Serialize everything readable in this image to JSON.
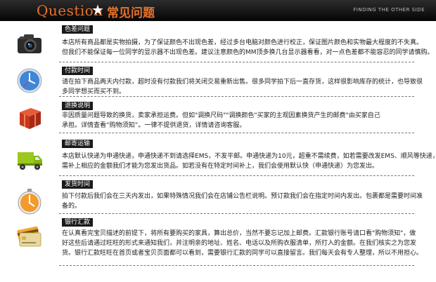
{
  "header": {
    "title_en": "Question",
    "star": "★",
    "title_cn": "常见问题",
    "right_text": "FINDING THE OTHER SIDE"
  },
  "sections": [
    {
      "icon": "camera-icon",
      "label": "色差问题",
      "lines": [
        "本店所有商品都是实物拍摄，为了保证颜色不出现色差，经过多台电脑对颜色进行校正，保证图片颜色和实物最大程度的不失真。",
        "但我们不能保证每一位同学的显示器不出现色差。建议注意颜色的MM顶多换几台显示器看看，对一点色差都不能容忍的同学请慎购。"
      ]
    },
    {
      "icon": "clock-icon",
      "label": "付款时间",
      "lines": [
        "请在拍下商品两天内付款，超时没有付款我们将关闭交易重新出售。很多同学拍下后一直存货，这样很影响库存的统计，也导致很",
        "多同学想买而买不到。"
      ]
    },
    {
      "icon": "package-icon",
      "label": "退换说明",
      "lines": [
        "非因质量问题导致的换货，卖家承担运费。但如\"调换尺码\"\"调换颜色\"买家的主观因素换货产生的邮费\"由买家自己",
        "承担。详情查看“购物须知”。一律不提供退货，详情请咨询客服。"
      ]
    },
    {
      "icon": "truck-icon",
      "label": "邮寄运输",
      "lines": [
        "本店默认快递为申通快递，申通快递不到请选择EMS，不发平邮。申通快递为10元，超重不需续费，如若需要改发EMS、顺风等快递，",
        "需补上相应的金额我们才能为您发出货品。如若没有在特定时间补上，我们会使用默认快（申通快递）为您发出。"
      ]
    },
    {
      "icon": "timer-icon",
      "label": "发货时间",
      "lines": [
        "拍下付款后我们会在三天内发出，如果特殊情况我们会在店铺公告栏说明。预订款我们会在指定时间内发出。包裹都是需要时间准",
        "备的。"
      ]
    },
    {
      "icon": "bank-card-icon",
      "label": "银行汇款",
      "lines": [
        "在认真看完宝贝描述的前提下，将所有要购买的家具，算出总价，当然不要忘记加上邮费。汇款银行账号请口看\"购物须知\"，做",
        "好这些后请通过旺旺的形式来通知我们，并注明亲的地址、姓名、电话以及所购衣服清单，所打入的金额。在我们核实之为您发",
        "货。银行汇款旺旺在首页或者宝贝页面都可以看到，需要银行汇款的同学可以直接留言。我们每天会有专人整理，所以不用担心。"
      ]
    }
  ]
}
